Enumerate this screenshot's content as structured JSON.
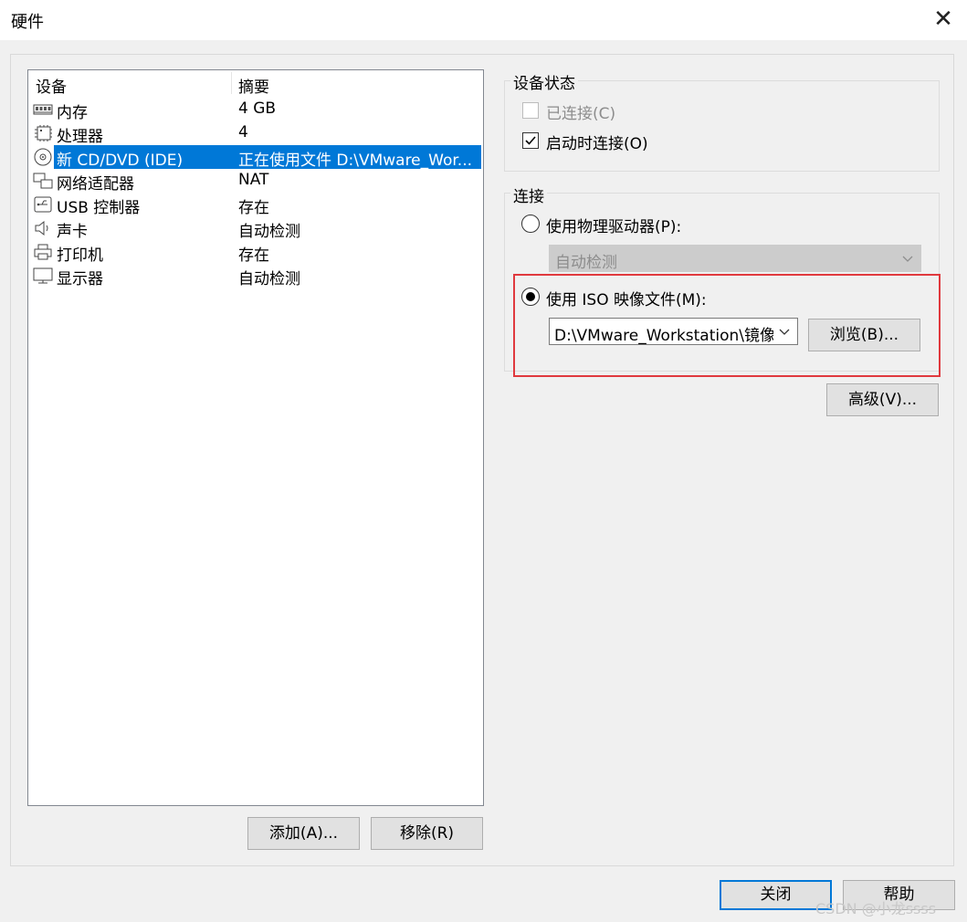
{
  "window": {
    "title": "硬件"
  },
  "device_list": {
    "columns": [
      "设备",
      "摘要"
    ],
    "rows": [
      {
        "name": "内存",
        "summary": "4 GB",
        "icon": "memory-icon"
      },
      {
        "name": "处理器",
        "summary": "4",
        "icon": "processor-icon"
      },
      {
        "name": "新 CD/DVD (IDE)",
        "summary": "正在使用文件 D:\\VMware_Wor...",
        "icon": "cd-dvd-icon",
        "selected": true
      },
      {
        "name": "网络适配器",
        "summary": "NAT",
        "icon": "network-adapter-icon"
      },
      {
        "name": "USB 控制器",
        "summary": "存在",
        "icon": "usb-icon"
      },
      {
        "name": "声卡",
        "summary": "自动检测",
        "icon": "sound-card-icon"
      },
      {
        "name": "打印机",
        "summary": "存在",
        "icon": "printer-icon"
      },
      {
        "name": "显示器",
        "summary": "自动检测",
        "icon": "monitor-icon"
      }
    ],
    "add_label": "添加(A)...",
    "remove_label": "移除(R)"
  },
  "device_status": {
    "title": "设备状态",
    "connected_label": "已连接(C)",
    "connected_checked": false,
    "connected_enabled": false,
    "connect_at_power_on_label": "启动时连接(O)",
    "connect_at_power_on_checked": true
  },
  "connection": {
    "title": "连接",
    "physical_drive_label": "使用物理驱动器(P):",
    "physical_drive_value": "自动检测",
    "iso_label": "使用 ISO 映像文件(M):",
    "iso_selected": true,
    "iso_path": "D:\\VMware_Workstation\\镜像\\",
    "browse_label": "浏览(B)..."
  },
  "advanced_label": "高级(V)...",
  "footer": {
    "close_label": "关闭",
    "help_label": "帮助"
  },
  "watermark": "CSDN @小龙ssss",
  "colors": {
    "selection": "#0078d7",
    "highlight_box": "#e0393e"
  }
}
